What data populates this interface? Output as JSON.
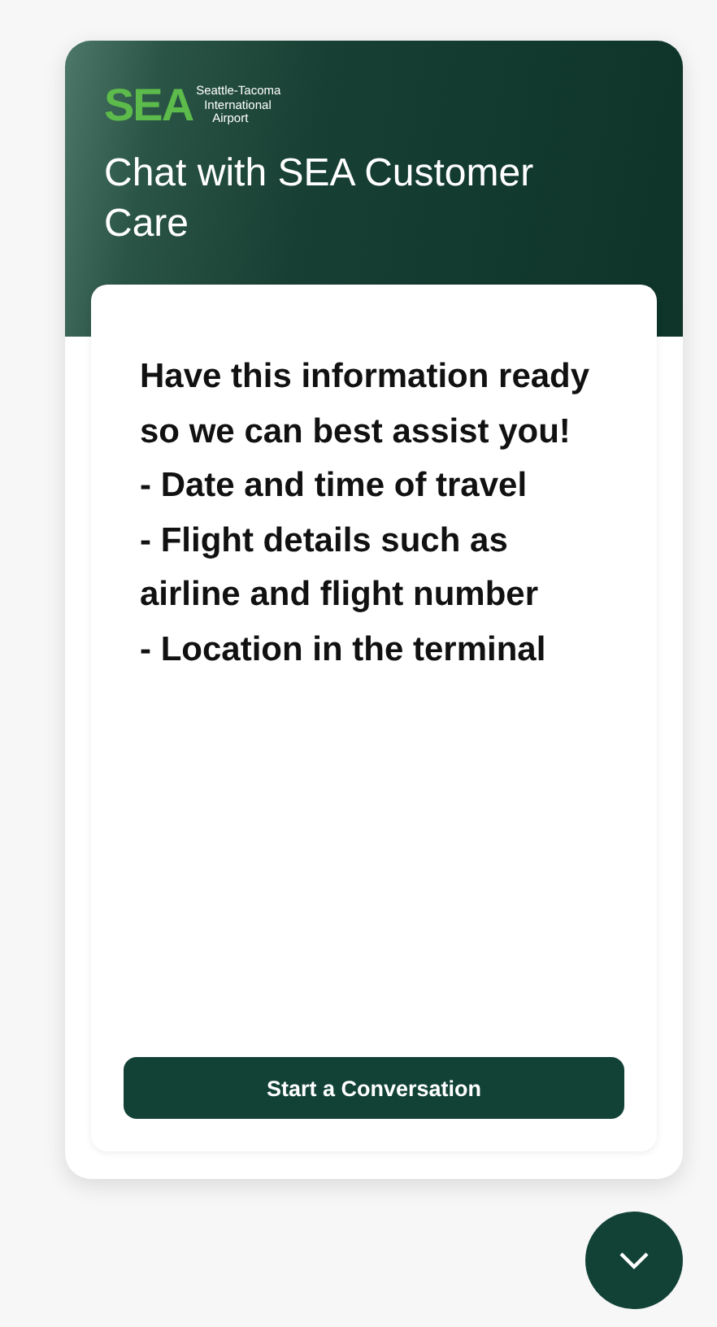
{
  "logo": {
    "mark": "SEA",
    "lines": [
      "Seattle-Tacoma",
      "International",
      "Airport"
    ]
  },
  "title": "Chat with SEA Customer Care",
  "message": {
    "heading": "Have this information ready so we can best assist you!",
    "items": [
      "- Date and time of travel",
      "- Flight details such as airline and flight number",
      "- Location in the terminal"
    ]
  },
  "button": "Start a Conversation"
}
